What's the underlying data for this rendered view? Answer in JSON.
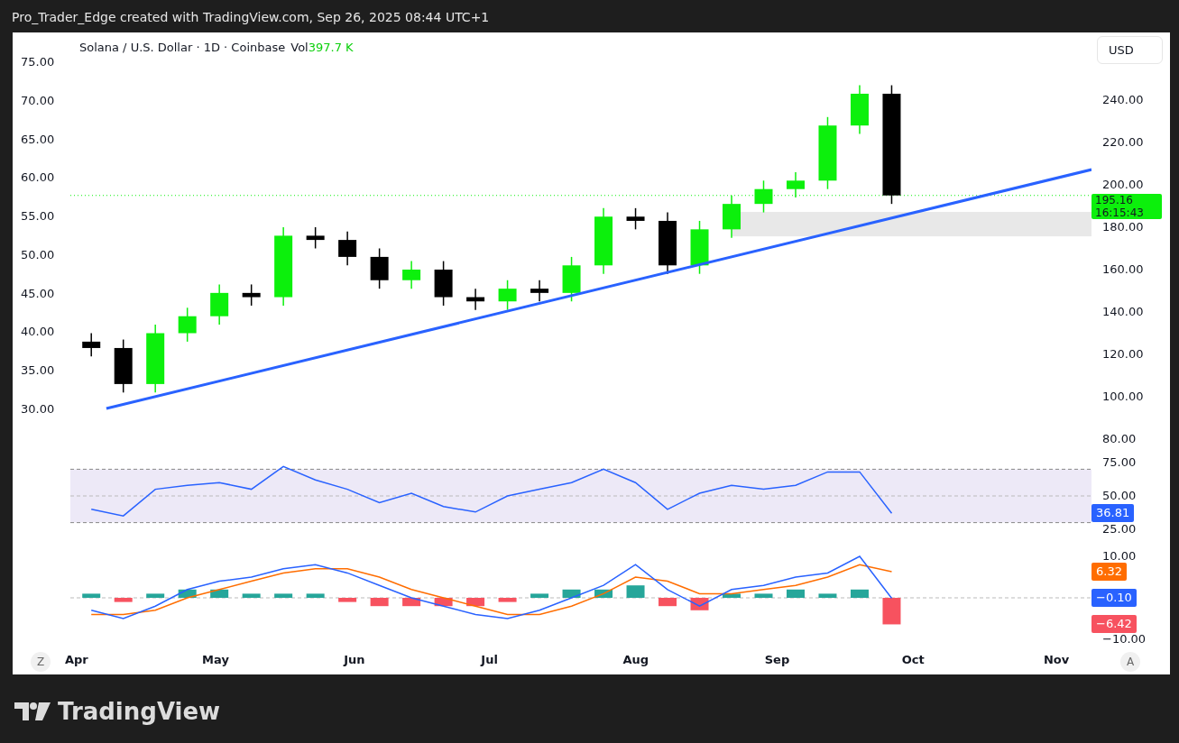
{
  "header": {
    "text": "Pro_Trader_Edge created with TradingView.com, Sep 26, 2025 08:44 UTC+1"
  },
  "chart": {
    "legend": {
      "symbol": "Solana / U.S. Dollar · 1D · Coinbase",
      "vol_label": "Vol",
      "vol_value": "397.7 K"
    },
    "currency_button": "USD",
    "left_scale": [
      "75.00",
      "70.00",
      "65.00",
      "60.00",
      "55.00",
      "50.00",
      "45.00",
      "40.00",
      "35.00",
      "30.00"
    ],
    "price_pane": {
      "axis_labels": [
        "240.00",
        "220.00",
        "200.00",
        "180.00",
        "160.00",
        "140.00",
        "120.00",
        "100.00",
        "80.00"
      ],
      "last_price": "195.16",
      "countdown": "16:15:43"
    },
    "rsi_pane": {
      "axis_labels": [
        "75.00",
        "50.00",
        "25.00"
      ],
      "value_badge": "36.81"
    },
    "macd_pane": {
      "axis_labels": [
        "10.00",
        "−10.00"
      ],
      "value_badges": [
        {
          "text": "6.32",
          "color": "#ff6d00"
        },
        {
          "text": "−0.10",
          "color": "#2962ff"
        },
        {
          "text": "−6.42",
          "color": "#f7525f"
        }
      ]
    },
    "time_axis": {
      "months": [
        "Apr",
        "May",
        "Jun",
        "Jul",
        "Aug",
        "Sep",
        "Oct",
        "Nov"
      ],
      "zoom_button": "Z",
      "auto_button": "A"
    }
  },
  "footer": {
    "brand": "TradingView"
  }
}
